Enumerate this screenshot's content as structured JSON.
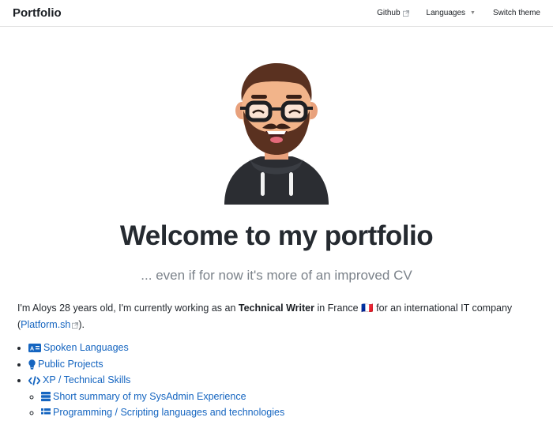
{
  "navbar": {
    "brand": "Portfolio",
    "github": "Github",
    "languages": "Languages",
    "switch_theme": "Switch theme"
  },
  "hero": {
    "avatar_icon": "bearded-man-avatar",
    "title": "Welcome to my portfolio",
    "subtitle": "... even if for now it's more of an improved CV"
  },
  "intro": {
    "part1": "I'm Aloys 28 years old, I'm currently working as an ",
    "bold": "Technical Writer",
    "part2": " in France ",
    "flag": "🇫🇷",
    "part3": " for an international IT company (",
    "link": "Platform.sh",
    "part4": ")."
  },
  "list": {
    "spoken_languages": "Spoken Languages",
    "public_projects": "Public Projects",
    "xp": "XP / Technical Skills",
    "sysadmin": "Short summary of my SysAdmin Experience",
    "languages_tools": "Programming / Scripting languages and technologies"
  },
  "colors": {
    "link": "#1565c0",
    "text": "#24292f",
    "muted": "#7b828a"
  }
}
